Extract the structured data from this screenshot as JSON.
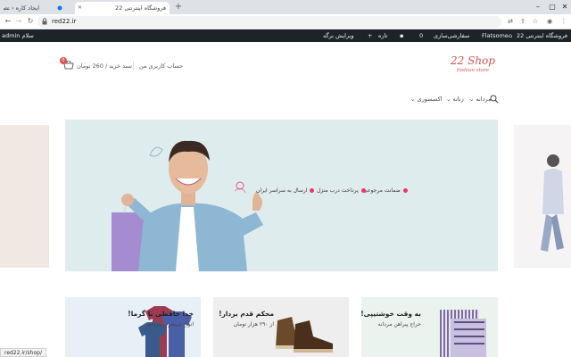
{
  "browser": {
    "tabs": [
      {
        "label": "ایجاد کاره ‹ تصاویر | انجام سایت"
      },
      {
        "label": ""
      },
      {
        "label": "فروشگاه اینترنتی 22"
      }
    ],
    "url": "red22.ir"
  },
  "admin_bar": {
    "site_name": "فروشگاه اینترنتی 22",
    "theme": "Flatsome",
    "customize": "سفارشی‌سازی",
    "comments_count": "0",
    "new": "تازه",
    "edit_with": "ویرایش برگه",
    "greeting": "سلام admin"
  },
  "header": {
    "logo_text": "22 Shop",
    "logo_sub": "fashion store",
    "account": "حساب کاربری من",
    "cart_text": "سبد خرید / 260 تومان",
    "cart_count": "0"
  },
  "nav": {
    "items": [
      {
        "label": "مردانه"
      },
      {
        "label": "زنانه"
      },
      {
        "label": "اکسسوری"
      }
    ]
  },
  "hero": {
    "features": [
      {
        "label": "ضمانت مرجوعی"
      },
      {
        "label": "پرداخت درب منزل"
      },
      {
        "label": "ارسال به سراسر ایران"
      }
    ]
  },
  "categories": [
    {
      "title": "خدا حافظی با گرما!",
      "subtitle": "انواع تی‌شرت مردانه"
    },
    {
      "title": "محکم قدم بردار!",
      "subtitle": "از ۲۹۰ هزار تومان"
    },
    {
      "title": "به وقت خوشتیپی!",
      "subtitle": "حراج پیراهن مردانه"
    }
  ],
  "status_bar": "red22.ir/shop/",
  "colors": {
    "brand": "#d9534f",
    "admin_bar": "#1d2327",
    "hero_bg": "#dfecee"
  }
}
